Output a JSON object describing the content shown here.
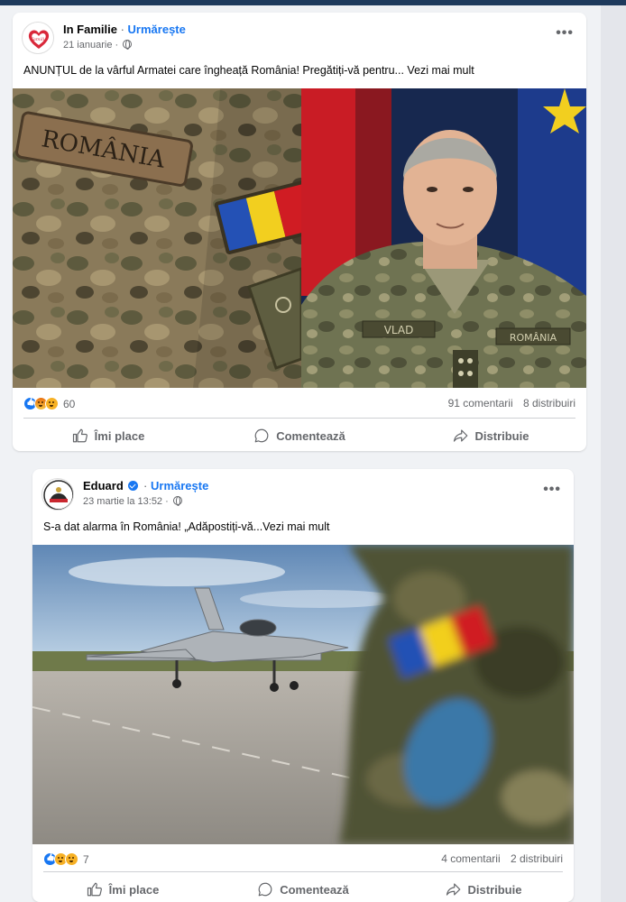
{
  "posts": [
    {
      "author": "In Familie",
      "follow_label": "Urmărește",
      "date": "21 ianuarie",
      "text": "ANUNȚUL de la vârful Armatei care îngheață România! Pregătiți-vă pentru... Vezi mai mult",
      "image_text": {
        "patch_label": "ROMÂNIA",
        "name_tag": "VLAD",
        "country_tag": "ROMÂNIA"
      },
      "reactions_count": "60",
      "comments": "91 comentarii",
      "shares": "8 distribuiri",
      "actions": {
        "like": "Îmi place",
        "comment": "Comentează",
        "share": "Distribuie"
      }
    },
    {
      "author": "Eduard",
      "follow_label": "Urmărește",
      "date": "23 martie la 13:52",
      "text": "S-a dat alarma în România! „Adăpostiți-vă...Vezi mai mult",
      "reactions_count": "7",
      "comments": "4 comentarii",
      "shares": "2 distribuiri",
      "actions": {
        "like": "Îmi place",
        "comment": "Comentează",
        "share": "Distribuie"
      }
    }
  ],
  "icons": {
    "more": "more-options-icon",
    "globe": "globe-icon",
    "like": "thumbs-up-icon",
    "comment": "comment-bubble-icon",
    "share": "share-arrow-icon"
  },
  "colors": {
    "accent": "#1877f2",
    "muted": "#65676b",
    "background": "#f0f2f5"
  }
}
